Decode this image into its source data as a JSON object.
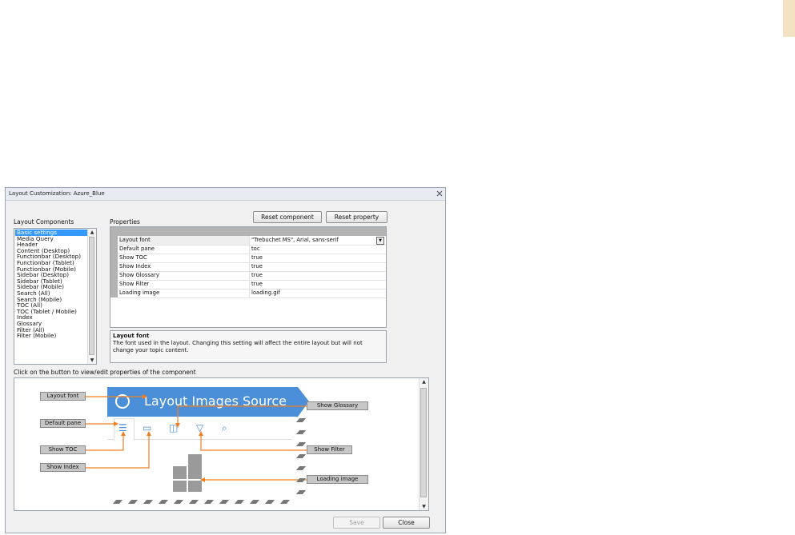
{
  "window": {
    "title": "Layout Customization: Azure_Blue"
  },
  "labels": {
    "layout_components": "Layout Components",
    "properties": "Properties",
    "preview_hint": "Click on the button to view/edit properties of the component"
  },
  "buttons": {
    "reset_component": "Reset component",
    "reset_property": "Reset property",
    "save": "Save",
    "close": "Close"
  },
  "components": [
    "Basic settings",
    "Media Query",
    "Header",
    "Content (Desktop)",
    "Functionbar (Desktop)",
    "Functionbar (Tablet)",
    "Functionbar (Mobile)",
    "Sidebar (Desktop)",
    "Sidebar (Tablet)",
    "Sidebar (Mobile)",
    "Search (All)",
    "Search (Mobile)",
    "TOC (All)",
    "TOC (Tablet / Mobile)",
    "Index",
    "Glossary",
    "Filter (All)",
    "Filter (Mobile)"
  ],
  "selected_component": "Basic settings",
  "properties": [
    {
      "name": "Layout font",
      "value": "\"Trebuchet MS\", Arial, sans-serif"
    },
    {
      "name": "Default pane",
      "value": "toc"
    },
    {
      "name": "Show TOC",
      "value": "true"
    },
    {
      "name": "Show Index",
      "value": "true"
    },
    {
      "name": "Show Glossary",
      "value": "true"
    },
    {
      "name": "Show Filter",
      "value": "true"
    },
    {
      "name": "Loading image",
      "value": "loading.gif"
    }
  ],
  "description": {
    "title": "Layout font",
    "text": "The font used in the layout. Changing this setting will affect the entire layout but will not change your topic content."
  },
  "preview": {
    "banner_title": "Layout Images Source",
    "callouts": {
      "layout_font": "Layout font",
      "default_pane": "Default pane",
      "show_toc": "Show TOC",
      "show_index": "Show Index",
      "show_glossary": "Show Glossary",
      "show_filter": "Show Filter",
      "loading_image": "Loading image"
    }
  },
  "colors": {
    "accent": "#4a8fd8",
    "arrow": "#f07f22",
    "selection": "#3399ff",
    "corner_tab": "#f3e3c2"
  }
}
